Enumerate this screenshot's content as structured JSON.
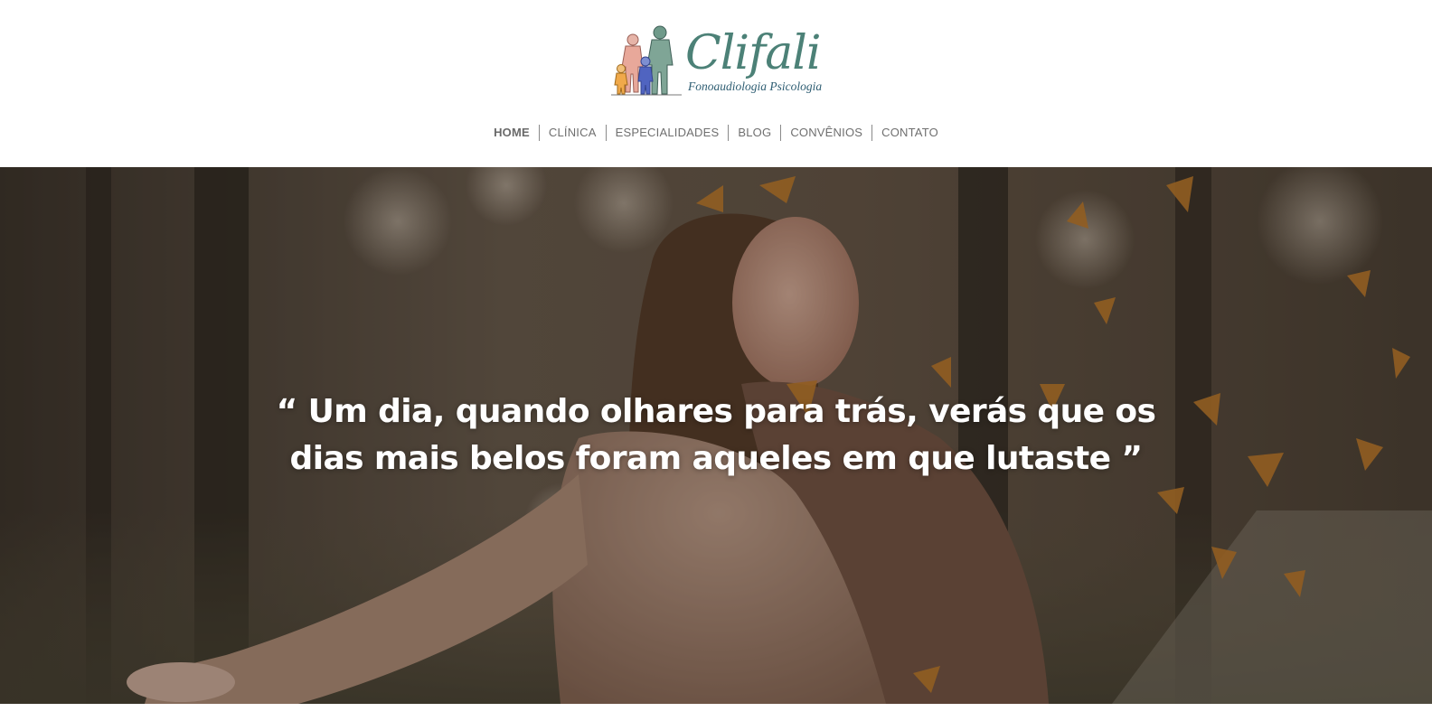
{
  "brand": {
    "name": "Clifali",
    "tagline": "Fonoaudiologia Psicologia",
    "color": "#4c8177",
    "tagline_color": "#2f5e73"
  },
  "nav": {
    "items": [
      {
        "label": "HOME",
        "active": true
      },
      {
        "label": "CLÍNICA",
        "active": false
      },
      {
        "label": "ESPECIALIDADES",
        "active": false
      },
      {
        "label": "BLOG",
        "active": false
      },
      {
        "label": "CONVÊNIOS",
        "active": false
      },
      {
        "label": "CONTATO",
        "active": false
      }
    ]
  },
  "hero": {
    "quote_line1": "“ Um dia, quando olhares para trás, verás que os",
    "quote_line2": "dias mais belos foram aqueles em que lutaste ”",
    "image": "woman-autumn-leaves-photo"
  }
}
